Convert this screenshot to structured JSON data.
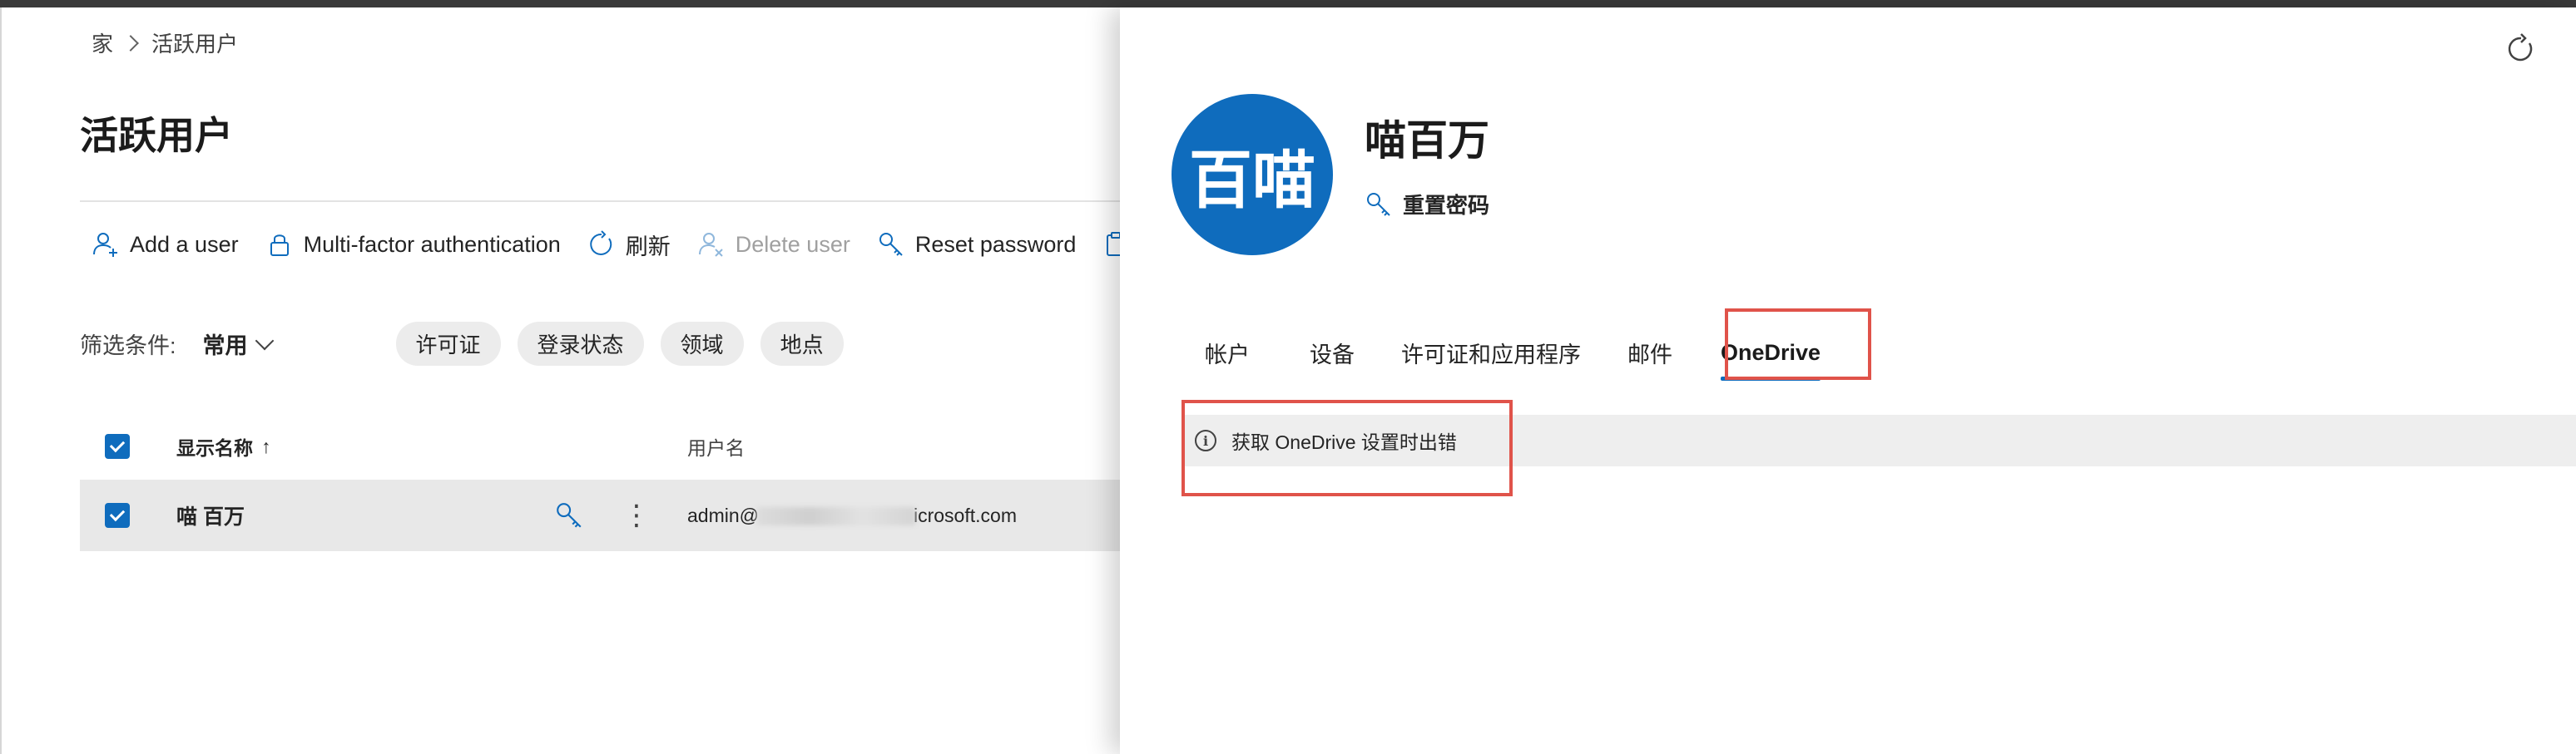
{
  "breadcrumb": {
    "home": "家",
    "current": "活跃用户"
  },
  "page": {
    "title": "活跃用户"
  },
  "toolbar": {
    "add_user": "Add a user",
    "mfa": "Multi-factor authentication",
    "refresh": "刷新",
    "delete_user": "Delete user",
    "reset_password": "Reset password"
  },
  "filter": {
    "label": "筛选条件:",
    "value": "常用",
    "pills": [
      "许可证",
      "登录状态",
      "领域",
      "地点"
    ]
  },
  "table": {
    "columns": {
      "display_name": "显示名称",
      "sort_indicator": "↑",
      "username": "用户名"
    },
    "rows": [
      {
        "display_name": "喵 百万",
        "username_prefix": "admin@",
        "username_suffix": "icrosoft.com"
      }
    ]
  },
  "panel": {
    "avatar_text": "百喵",
    "user_name": "喵百万",
    "reset_password": "重置密码",
    "tabs": [
      "帐户",
      "设备",
      "许可证和应用程序",
      "邮件",
      "OneDrive"
    ],
    "active_tab": "OneDrive",
    "message": "获取 OneDrive 设置时出错"
  },
  "colors": {
    "accent": "#0f6cbd",
    "highlight_box": "#e0534a",
    "row_selected": "#e8e8e8",
    "message_bar": "#eeeeee"
  },
  "icons": {
    "add_user": "person-add-icon",
    "mfa": "lock-icon",
    "refresh": "refresh-icon",
    "delete_user": "person-delete-icon",
    "reset_password": "key-icon",
    "more": "more-vertical-icon",
    "info": "info-icon"
  }
}
